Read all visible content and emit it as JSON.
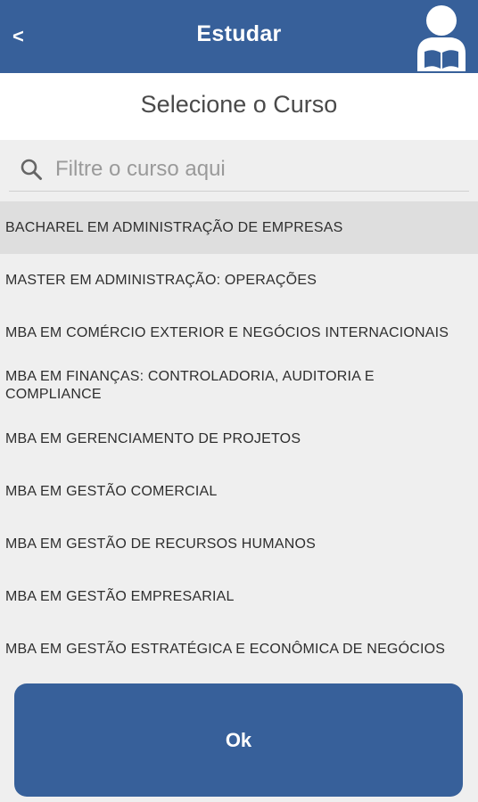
{
  "header": {
    "back_label": "<",
    "title": "Estudar",
    "avatar_icon": "reading-person-icon"
  },
  "subtitle": "Selecione o Curso",
  "search": {
    "placeholder": "Filtre o curso aqui",
    "value": "",
    "icon": "search-icon"
  },
  "courses": [
    {
      "label": "BACHAREL EM ADMINISTRAÇÃO DE EMPRESAS",
      "selected": true
    },
    {
      "label": "MASTER EM ADMINISTRAÇÃO: OPERAÇÕES",
      "selected": false
    },
    {
      "label": "MBA EM COMÉRCIO EXTERIOR E NEGÓCIOS INTERNACIONAIS",
      "selected": false
    },
    {
      "label": "MBA EM FINANÇAS: CONTROLADORIA, AUDITORIA E COMPLIANCE",
      "selected": false
    },
    {
      "label": "MBA EM GERENCIAMENTO DE PROJETOS",
      "selected": false
    },
    {
      "label": "MBA EM GESTÃO COMERCIAL",
      "selected": false
    },
    {
      "label": "MBA EM GESTÃO DE RECURSOS HUMANOS",
      "selected": false
    },
    {
      "label": "MBA EM GESTÃO EMPRESARIAL",
      "selected": false
    },
    {
      "label": "MBA EM GESTÃO ESTRATÉGICA E ECONÔMICA DE NEGÓCIOS",
      "selected": false
    }
  ],
  "ok_label": "Ok",
  "colors": {
    "primary": "#37609a",
    "background": "#efefef",
    "selected_row": "#dedede"
  }
}
